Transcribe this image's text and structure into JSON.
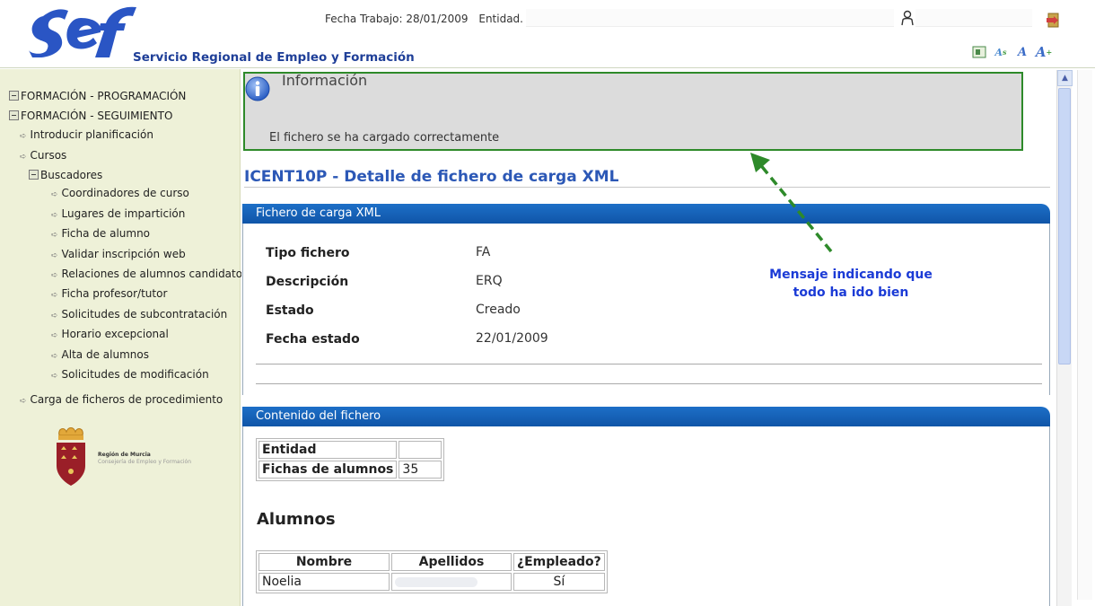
{
  "header": {
    "org_name": "Servicio Regional de Empleo y Formación",
    "work_date": "Fecha Trabajo: 28/01/2009",
    "entity_label": "Entidad.",
    "colors": {
      "brand_blue": "#1f3f98",
      "logo_blue": "#2a55c4"
    }
  },
  "sidebar": {
    "items": [
      {
        "label": "FORMACIÓN - PROGRAMACIÓN"
      },
      {
        "label": "FORMACIÓN - SEGUIMIENTO"
      },
      {
        "label": "Introducir planificación"
      },
      {
        "label": "Cursos"
      },
      {
        "label": "Buscadores"
      },
      {
        "label": "Coordinadores de curso"
      },
      {
        "label": "Lugares de impartición"
      },
      {
        "label": "Ficha de alumno"
      },
      {
        "label": "Validar inscripción web"
      },
      {
        "label": "Relaciones de alumnos candidatos"
      },
      {
        "label": "Ficha profesor/tutor"
      },
      {
        "label": "Solicitudes de subcontratación"
      },
      {
        "label": "Horario excepcional"
      },
      {
        "label": "Alta de alumnos"
      },
      {
        "label": "Solicitudes de modificación"
      },
      {
        "label": "Carga de ficheros de procedimiento"
      }
    ],
    "region_line1": "Región de Murcia",
    "region_line2": "Consejería de Empleo y Formación"
  },
  "info": {
    "title": "Información",
    "message": "El fichero se ha cargado correctamente"
  },
  "page": {
    "title": "ICENT10P - Detalle de fichero de carga XML"
  },
  "fichero": {
    "section_title": "Fichero de carga XML",
    "rows": [
      {
        "label": "Tipo fichero",
        "value": "FA"
      },
      {
        "label": "Descripción",
        "value": "ERQ"
      },
      {
        "label": "Estado",
        "value": "Creado"
      },
      {
        "label": "Fecha estado",
        "value": "22/01/2009"
      }
    ]
  },
  "contenido": {
    "section_title": "Contenido del fichero",
    "entidad_label": "Entidad",
    "entidad_value": "",
    "fichas_label": "Fichas de alumnos",
    "fichas_value": "35",
    "alumnos_heading": "Alumnos",
    "columns": [
      "Nombre",
      "Apellidos",
      "¿Empleado?"
    ],
    "rows": [
      {
        "nombre": "Noelia",
        "apellidos": "",
        "empleado": "Sí"
      }
    ]
  },
  "annotation": {
    "line1": "Mensaje indicando que",
    "line2": "todo ha ido bien",
    "color": "#1b3bd6",
    "arrow_color": "#2e8a2a"
  }
}
